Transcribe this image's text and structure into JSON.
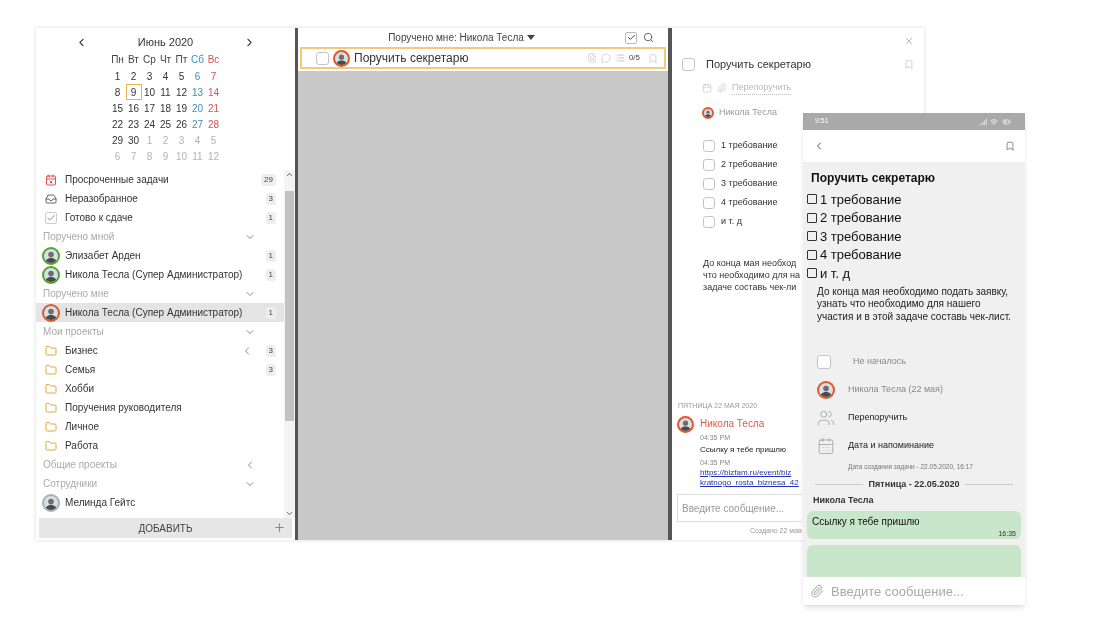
{
  "calendar": {
    "month": "Июнь 2020",
    "weekdays": [
      "Пн",
      "Вт",
      "Ср",
      "Чт",
      "Пт",
      "Сб",
      "Вс"
    ],
    "weeks": [
      [
        {
          "d": "1",
          "muted": false,
          "selected": false
        },
        {
          "d": "2",
          "muted": false,
          "selected": false
        },
        {
          "d": "3",
          "muted": false,
          "selected": false
        },
        {
          "d": "4",
          "muted": false,
          "selected": false
        },
        {
          "d": "5",
          "muted": false,
          "selected": false
        },
        {
          "d": "6",
          "muted": false,
          "selected": false
        },
        {
          "d": "7",
          "muted": false,
          "selected": false
        }
      ],
      [
        {
          "d": "8",
          "muted": false,
          "selected": false
        },
        {
          "d": "9",
          "muted": false,
          "selected": true
        },
        {
          "d": "10",
          "muted": false,
          "selected": false
        },
        {
          "d": "11",
          "muted": false,
          "selected": false
        },
        {
          "d": "12",
          "muted": false,
          "selected": false
        },
        {
          "d": "13",
          "muted": false,
          "selected": false
        },
        {
          "d": "14",
          "muted": false,
          "selected": false
        }
      ],
      [
        {
          "d": "15",
          "muted": false,
          "selected": false
        },
        {
          "d": "16",
          "muted": false,
          "selected": false
        },
        {
          "d": "17",
          "muted": false,
          "selected": false
        },
        {
          "d": "18",
          "muted": false,
          "selected": false
        },
        {
          "d": "19",
          "muted": false,
          "selected": false
        },
        {
          "d": "20",
          "muted": false,
          "selected": false
        },
        {
          "d": "21",
          "muted": false,
          "selected": false
        }
      ],
      [
        {
          "d": "22",
          "muted": false,
          "selected": false
        },
        {
          "d": "23",
          "muted": false,
          "selected": false
        },
        {
          "d": "24",
          "muted": false,
          "selected": false
        },
        {
          "d": "25",
          "muted": false,
          "selected": false
        },
        {
          "d": "26",
          "muted": false,
          "selected": false
        },
        {
          "d": "27",
          "muted": false,
          "selected": false
        },
        {
          "d": "28",
          "muted": false,
          "selected": false
        }
      ],
      [
        {
          "d": "29",
          "muted": false,
          "selected": false
        },
        {
          "d": "30",
          "muted": false,
          "selected": false
        },
        {
          "d": "1",
          "muted": true,
          "selected": false
        },
        {
          "d": "2",
          "muted": true,
          "selected": false
        },
        {
          "d": "3",
          "muted": true,
          "selected": false
        },
        {
          "d": "4",
          "muted": true,
          "selected": false
        },
        {
          "d": "5",
          "muted": true,
          "selected": false
        }
      ],
      [
        {
          "d": "6",
          "muted": true,
          "selected": false
        },
        {
          "d": "7",
          "muted": true,
          "selected": false
        },
        {
          "d": "8",
          "muted": true,
          "selected": false
        },
        {
          "d": "9",
          "muted": true,
          "selected": false
        },
        {
          "d": "10",
          "muted": true,
          "selected": false
        },
        {
          "d": "11",
          "muted": true,
          "selected": false
        },
        {
          "d": "12",
          "muted": true,
          "selected": false
        }
      ]
    ]
  },
  "sidebar": {
    "items": [
      {
        "kind": "overdue",
        "label": "Просроченные задачи",
        "count": "29",
        "selected": false
      },
      {
        "kind": "inbox",
        "label": "Неразобранное",
        "count": "3",
        "selected": false
      },
      {
        "kind": "done",
        "label": "Готово к сдаче",
        "count": "1",
        "selected": false
      },
      {
        "kind": "section",
        "label": "Поручено мной",
        "expanded": true
      },
      {
        "kind": "person",
        "label": "Элизабет Арден",
        "count": "1",
        "color": "#5aa02c",
        "selected": false
      },
      {
        "kind": "person",
        "label": "Никола Тесла (Супер Администратор)",
        "count": "1",
        "color": "#5aa02c",
        "selected": false
      },
      {
        "kind": "section",
        "label": "Поручено мне",
        "expanded": true
      },
      {
        "kind": "person",
        "label": "Никола Тесла (Супер Администратор)",
        "count": "1",
        "color": "#e2572b",
        "selected": true
      },
      {
        "kind": "section",
        "label": "Мои проекты",
        "expanded": true
      },
      {
        "kind": "project",
        "label": "Бизнес",
        "count": "3",
        "expanded": false,
        "selected": false
      },
      {
        "kind": "project",
        "label": "Семья",
        "count": "3",
        "selected": false
      },
      {
        "kind": "project",
        "label": "Хобби",
        "selected": false
      },
      {
        "kind": "project",
        "label": "Поручения руководителя",
        "selected": false
      },
      {
        "kind": "project",
        "label": "Личное",
        "selected": false
      },
      {
        "kind": "project",
        "label": "Работа",
        "selected": false
      },
      {
        "kind": "section",
        "label": "Общие проекты",
        "expanded": false
      },
      {
        "kind": "section",
        "label": "Сотрудники",
        "expanded": true
      },
      {
        "kind": "person",
        "label": "Мелинда Гейтс",
        "color": "#b0b0b0",
        "selected": false
      }
    ],
    "add_button": "ДОБАВИТЬ"
  },
  "task_list": {
    "filter": "Поручено мне: Никола Тесла",
    "show_done": true,
    "tasks": [
      {
        "title": "Поручить секретарю",
        "checked": false,
        "selected": true,
        "progress": "0/5"
      }
    ]
  },
  "task_detail": {
    "checked": false,
    "title": "Поручить секретарю",
    "reassign": "Перепоручить",
    "assignee": "Никола Тесла",
    "checklist": [
      {
        "label": "1 требование",
        "checked": false
      },
      {
        "label": "2 требование",
        "checked": false
      },
      {
        "label": "3 требование",
        "checked": false
      },
      {
        "label": "4 требование",
        "checked": false
      },
      {
        "label": "и т. д",
        "checked": false
      }
    ],
    "description_lines": [
      "До конца мая необход",
      "что необходимо для на",
      "задаче составь чек-ли"
    ],
    "date_separator": "ПЯТНИЦА 22 МАЯ 2020",
    "author": "Никола Тесла",
    "messages": [
      {
        "time": "04:35 PM",
        "text": "Ссылку я тебе пришлю",
        "kind": "text"
      },
      {
        "time": "04:35 PM",
        "text": "https://bizfam.ru/event/biz\nkratnogo_rosta_biznesa_42",
        "kind": "link"
      }
    ],
    "input": {
      "placeholder": "Введите сообщение..."
    },
    "created": "Создано 22 мая"
  },
  "phone": {
    "time": "9:51",
    "title": "Поручить секретарю",
    "checklist": [
      {
        "label": "1 требование",
        "checked": false
      },
      {
        "label": "2 требование",
        "checked": false
      },
      {
        "label": "3 требование",
        "checked": false
      },
      {
        "label": "4 требование",
        "checked": false
      },
      {
        "label": "и т. д",
        "checked": false
      }
    ],
    "description": "До конца мая необходимо подать заявку, узнать что необходимо для нашего участия и в этой задаче составь чек-лист.",
    "status": {
      "label": "Не началось",
      "checked": false
    },
    "assignee": "Никола Тесла (22 мая)",
    "actions": [
      {
        "kind": "reassign",
        "label": "Перепоручить"
      },
      {
        "kind": "date",
        "label": "Дата и напоминание"
      }
    ],
    "created": "Дата создания задачи - 22.05.2020, 16:17",
    "date_separator": "Пятница - 22.05.2020",
    "author": "Никола Тесла",
    "messages": [
      {
        "text": "Ссылку я тебе пришлю",
        "time": "16:35"
      }
    ],
    "input": {
      "placeholder": "Введите сообщение..."
    }
  }
}
